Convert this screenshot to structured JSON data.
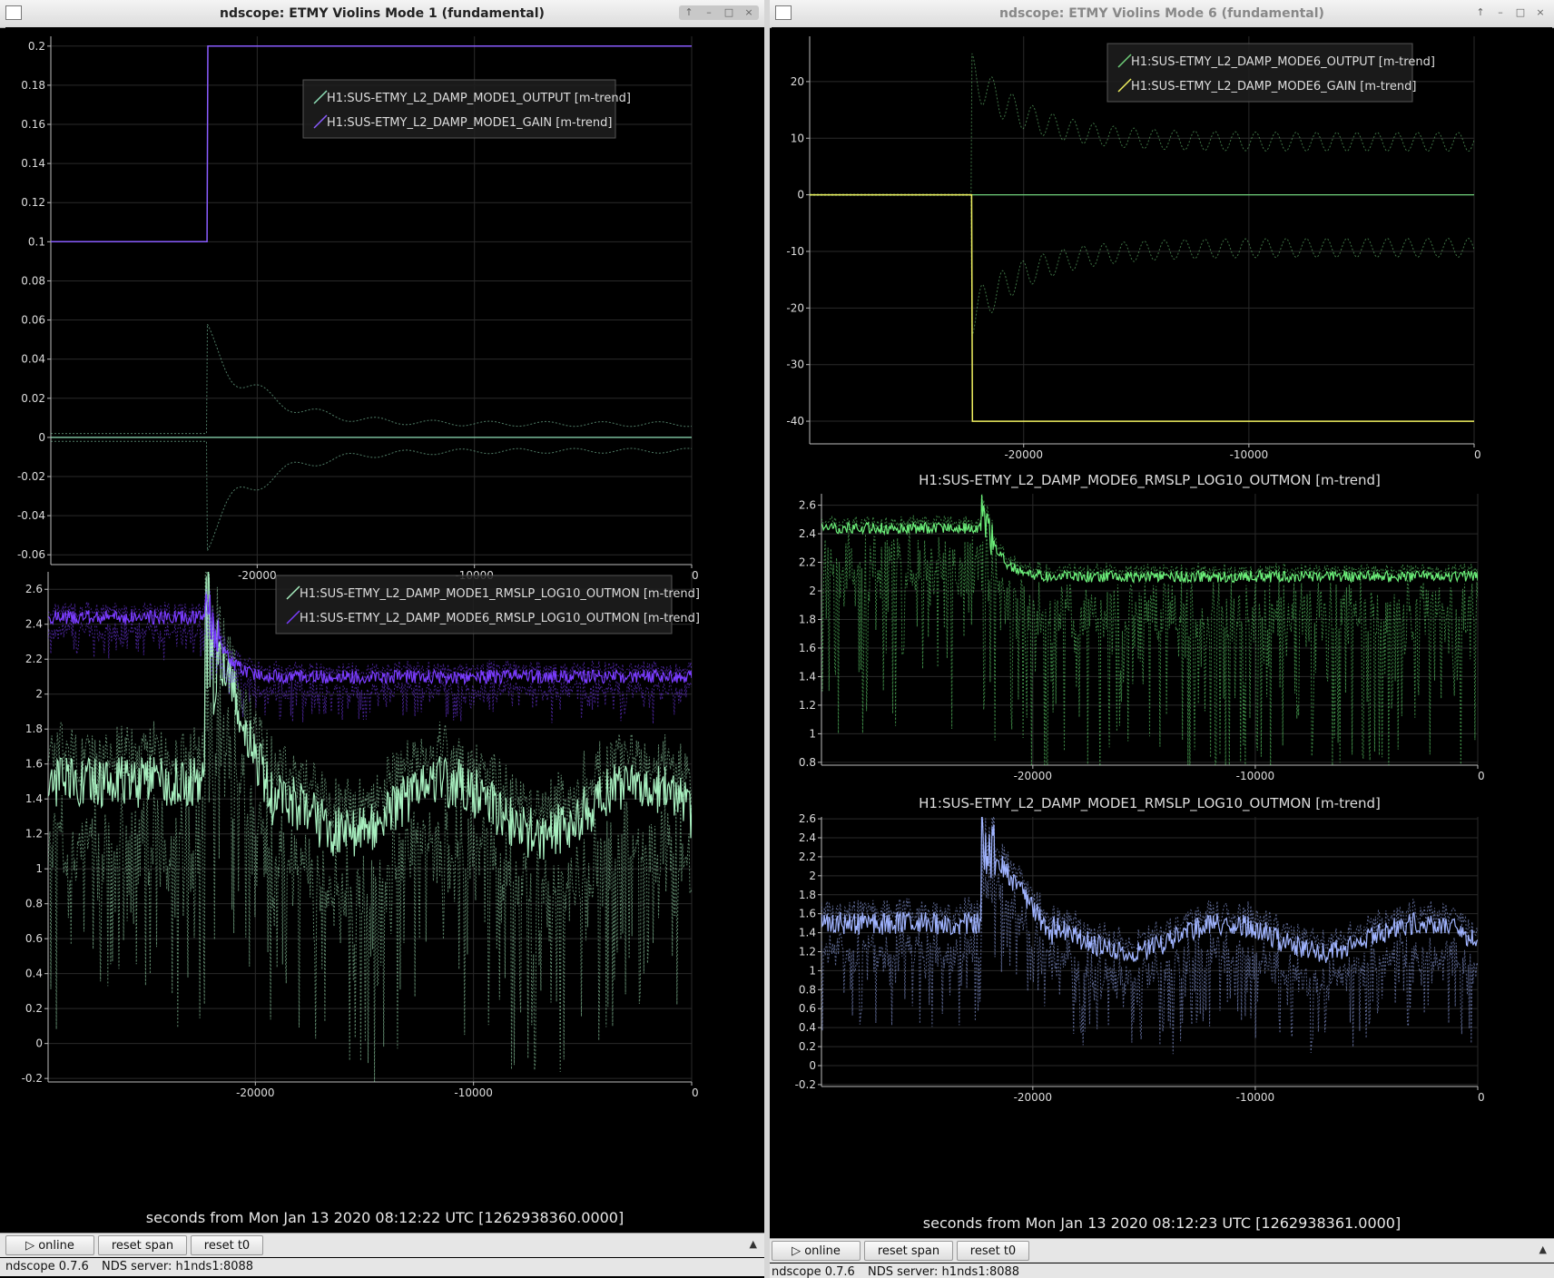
{
  "windows": [
    {
      "id": "left",
      "title": "ndscope: ETMY Violins Mode 1 (fundamental)",
      "title_buttons": [
        "↑",
        "–",
        "□",
        "×"
      ],
      "x_caption": "seconds from Mon Jan 13 2020 08:12:22 UTC [1262938360.0000]",
      "controls": {
        "online": "▷ online",
        "reset_span": "reset span",
        "reset_t0": "reset t0",
        "collapse": "▲"
      },
      "status": {
        "version": "ndscope 0.7.6",
        "server": "NDS server: h1nds1:8088"
      }
    },
    {
      "id": "right",
      "title": "ndscope: ETMY Violins Mode 6 (fundamental)",
      "title_buttons": [
        "↑",
        "–",
        "□",
        "×"
      ],
      "x_caption": "seconds from Mon Jan 13 2020 08:12:23 UTC [1262938361.0000]",
      "controls": {
        "online": "▷ online",
        "reset_span": "reset span",
        "reset_t0": "reset t0",
        "collapse": "▲"
      },
      "status": {
        "version": "ndscope 0.7.6",
        "server": "NDS server: h1nds1:8088"
      }
    }
  ],
  "chart_data": [
    {
      "id": "L1",
      "type": "line",
      "title": "",
      "xlim": [
        -29500,
        0
      ],
      "ylim": [
        -0.065,
        0.205
      ],
      "xticks": [
        -20000,
        -10000,
        0
      ],
      "yticks": [
        0.2,
        0.18,
        0.16,
        0.14,
        0.12,
        0.1,
        0.08,
        0.06,
        0.04,
        0.02,
        0,
        -0.02,
        -0.04,
        -0.06
      ],
      "legend": "top-right",
      "series": [
        {
          "name": "H1:SUS-ETMY_L2_DAMP_MODE1_OUTPUT [m-trend]",
          "color": "#8fe0b8",
          "kind": "decay",
          "t0": -22300,
          "base": 0,
          "env_before": 0.002,
          "env_peak": 0.058,
          "env_after": 0.008,
          "tau": 2500,
          "osc_period": 2600
        },
        {
          "name": "H1:SUS-ETMY_L2_DAMP_MODE1_GAIN [m-trend]",
          "color": "#8a5cff",
          "kind": "step",
          "t0": -22300,
          "before": 0.1,
          "after": 0.2
        }
      ]
    },
    {
      "id": "L2",
      "type": "line",
      "title": "",
      "xlim": [
        -29500,
        0
      ],
      "ylim": [
        -0.22,
        2.7
      ],
      "xticks": [
        -20000,
        -10000,
        0
      ],
      "yticks": [
        2.6,
        2.4,
        2.2,
        2,
        1.8,
        1.6,
        1.4,
        1.2,
        1,
        0.8,
        0.6,
        0.4,
        0.2,
        0,
        -0.2
      ],
      "legend": "top-right",
      "series": [
        {
          "name": "H1:SUS-ETMY_L2_DAMP_MODE1_RMSLP_LOG10_OUTMON [m-trend]",
          "color": "#a8f0c0",
          "kind": "mode1",
          "t0": -22300,
          "pre": 1.5,
          "peak": 2.45,
          "post": 1.35,
          "noise": 0.15,
          "min_drop": 1.2,
          "seed": 3
        },
        {
          "name": "H1:SUS-ETMY_L2_DAMP_MODE6_RMSLP_LOG10_OUTMON [m-trend]",
          "color": "#7a3cff",
          "kind": "mode6",
          "t0": -22300,
          "pre": 2.44,
          "peak": 2.6,
          "post": 2.1,
          "noise": 0.04,
          "min_drop": 0.2,
          "seed": 7
        }
      ]
    },
    {
      "id": "R1",
      "type": "line",
      "title": "",
      "xlim": [
        -29500,
        0
      ],
      "ylim": [
        -44,
        28
      ],
      "xticks": [
        -20000,
        -10000,
        0
      ],
      "yticks": [
        20,
        10,
        0,
        -10,
        -20,
        -30,
        -40
      ],
      "legend": "top-right",
      "series": [
        {
          "name": "H1:SUS-ETMY_L2_DAMP_MODE6_OUTPUT [m-trend]",
          "color": "#6fd07a",
          "kind": "decay",
          "t0": -22300,
          "base": 0,
          "env_before": 0.1,
          "env_peak": 25,
          "env_after": 11,
          "tau": 2500,
          "osc_period": 900
        },
        {
          "name": "H1:SUS-ETMY_L2_DAMP_MODE6_GAIN [m-trend]",
          "color": "#f0f060",
          "kind": "step",
          "t0": -22300,
          "before": 0,
          "after": -40
        }
      ]
    },
    {
      "id": "R2",
      "type": "line",
      "title": "H1:SUS-ETMY_L2_DAMP_MODE6_RMSLP_LOG10_OUTMON [m-trend]",
      "xlim": [
        -29500,
        0
      ],
      "ylim": [
        0.78,
        2.68
      ],
      "xticks": [
        -20000,
        -10000,
        0
      ],
      "yticks": [
        2.6,
        2.4,
        2.2,
        2,
        1.8,
        1.6,
        1.4,
        1.2,
        1,
        0.8
      ],
      "legend": "none",
      "series": [
        {
          "name": "",
          "color": "#6cf07a",
          "kind": "mode6",
          "t0": -22300,
          "pre": 2.44,
          "peak": 2.6,
          "post": 2.1,
          "noise": 0.04,
          "min_drop": 1.4,
          "seed": 11
        }
      ]
    },
    {
      "id": "R3",
      "type": "line",
      "title": "H1:SUS-ETMY_L2_DAMP_MODE1_RMSLP_LOG10_OUTMON [m-trend]",
      "xlim": [
        -29500,
        0
      ],
      "ylim": [
        -0.22,
        2.62
      ],
      "xticks": [
        -20000,
        -10000,
        0
      ],
      "yticks": [
        2.6,
        2.4,
        2.2,
        2,
        1.8,
        1.6,
        1.4,
        1.2,
        1,
        0.8,
        0.6,
        0.4,
        0.2,
        0,
        -0.2
      ],
      "legend": "none",
      "series": [
        {
          "name": "",
          "color": "#a0b4ff",
          "kind": "mode1",
          "t0": -22300,
          "pre": 1.5,
          "peak": 2.43,
          "post": 1.35,
          "noise": 0.12,
          "min_drop": 1.0,
          "seed": 5
        }
      ]
    }
  ]
}
